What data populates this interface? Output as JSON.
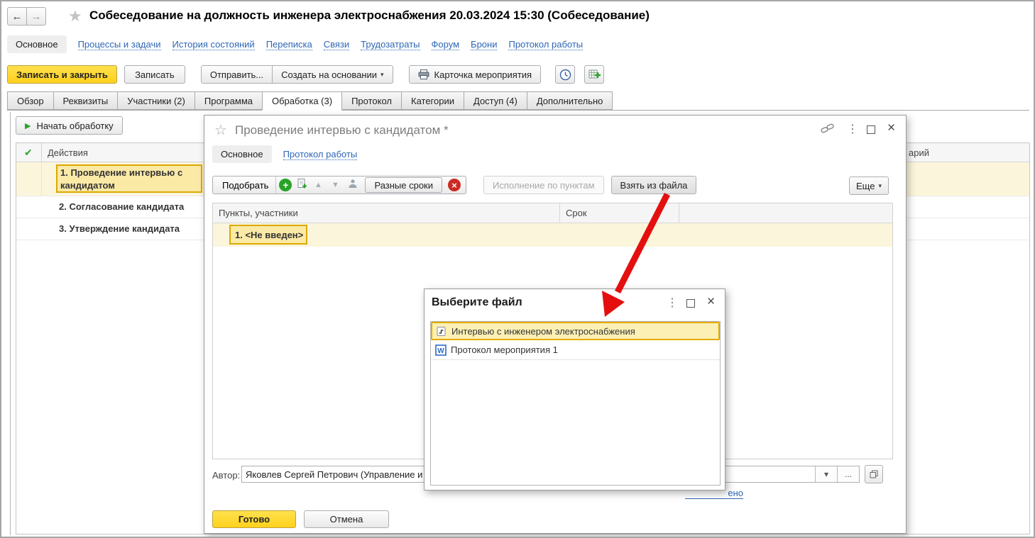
{
  "main": {
    "title": "Собеседование на должность инженера электроснабжения 20.03.2024 15:30 (Собеседование)",
    "nav": {
      "active": "Основное",
      "links": [
        "Процессы и задачи",
        "История состояний",
        "Переписка",
        "Связи",
        "Трудозатраты",
        "Форум",
        "Брони",
        "Протокол работы"
      ]
    },
    "commands": {
      "save_close": "Записать и закрыть",
      "save": "Записать",
      "send": "Отправить...",
      "create_from": "Создать на основании",
      "event_card": "Карточка мероприятия"
    },
    "tabs": [
      "Обзор",
      "Реквизиты",
      "Участники (2)",
      "Программа",
      "Обработка (3)",
      "Протокол",
      "Категории",
      "Доступ (4)",
      "Дополнительно"
    ],
    "processing": {
      "start": "Начать обработку",
      "actions_header": "Действия",
      "rows": [
        "1. Проведение интервью с кандидатом",
        "2. Согласование кандидата",
        "3. Утверждение кандидата"
      ],
      "comment_header_partial": "арий"
    }
  },
  "dialog": {
    "title": "Проведение интервью с кандидатом *",
    "nav": {
      "active": "Основное",
      "link": "Протокол работы"
    },
    "toolbar": {
      "pick": "Подобрать",
      "different_terms": "Разные сроки",
      "exec_by_items": "Исполнение по пунктам",
      "take_from_file": "Взять из файла",
      "more": "Еще"
    },
    "table": {
      "col_items": "Пункты, участники",
      "col_term": "Срок",
      "row1": "1. <Не введен>"
    },
    "author": {
      "label": "Автор:",
      "value": "Яковлев Сергей Петрович (Управление и"
    },
    "partial_link": "ено",
    "done": "Готово",
    "cancel": "Отмена"
  },
  "file_dialog": {
    "title": "Выберите файл",
    "files": [
      {
        "name": "Интервью с инженером электроснабжения"
      },
      {
        "name": "Протокол мероприятия 1",
        "icon_letter": "W"
      }
    ]
  },
  "icons": {
    "back": "←",
    "forward": "→",
    "star": "★",
    "star_outline": "☆",
    "play": "▶",
    "check": "✔",
    "plus": "+",
    "up": "▲",
    "down": "▼",
    "close": "×",
    "kebab": "⋮",
    "caret": "▾",
    "ellipsis": "..."
  },
  "colors": {
    "accent_yellow": "#ffd11c",
    "selection_yellow": "#fcf0b0",
    "selection_border": "#dca900",
    "row_yellow": "#fbf5db",
    "link_blue": "#2d66b5",
    "arrow_red": "#e40f0f"
  }
}
